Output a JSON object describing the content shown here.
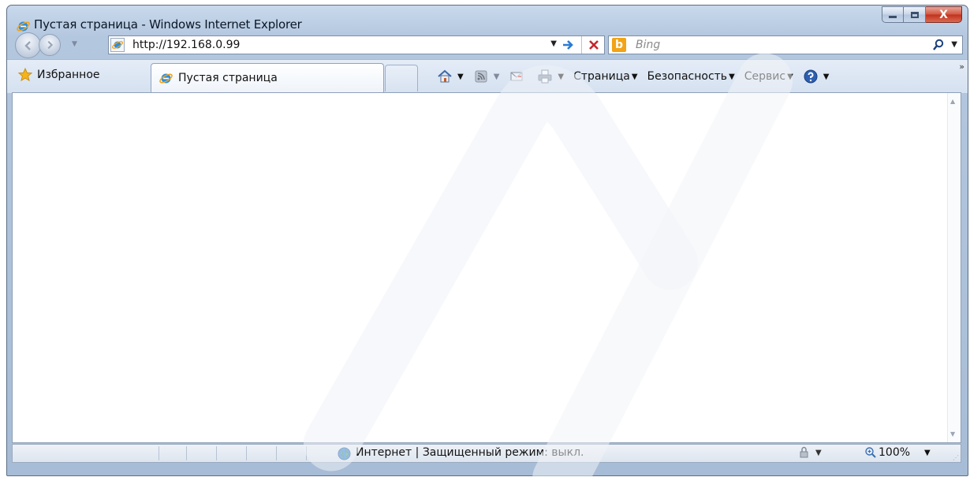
{
  "window": {
    "title": "Пустая страница - Windows Internet Explorer",
    "close_glyph": "X"
  },
  "address_bar": {
    "url": "http://192.168.0.99"
  },
  "search": {
    "placeholder": "Bing"
  },
  "command_bar": {
    "favorites_label": "Избранное",
    "tab_label": "Пустая страница",
    "page_menu": "Страница",
    "safety_menu": "Безопасность",
    "tools_menu": "Сервис"
  },
  "status_bar": {
    "zone_text": "Интернет | Защищенный режим: выкл.",
    "zoom": "100%"
  },
  "colors": {
    "frame": "#b3c7df",
    "close_button": "#c0311c",
    "accent_go": "#2a7bd3",
    "stop": "#c6262d"
  }
}
